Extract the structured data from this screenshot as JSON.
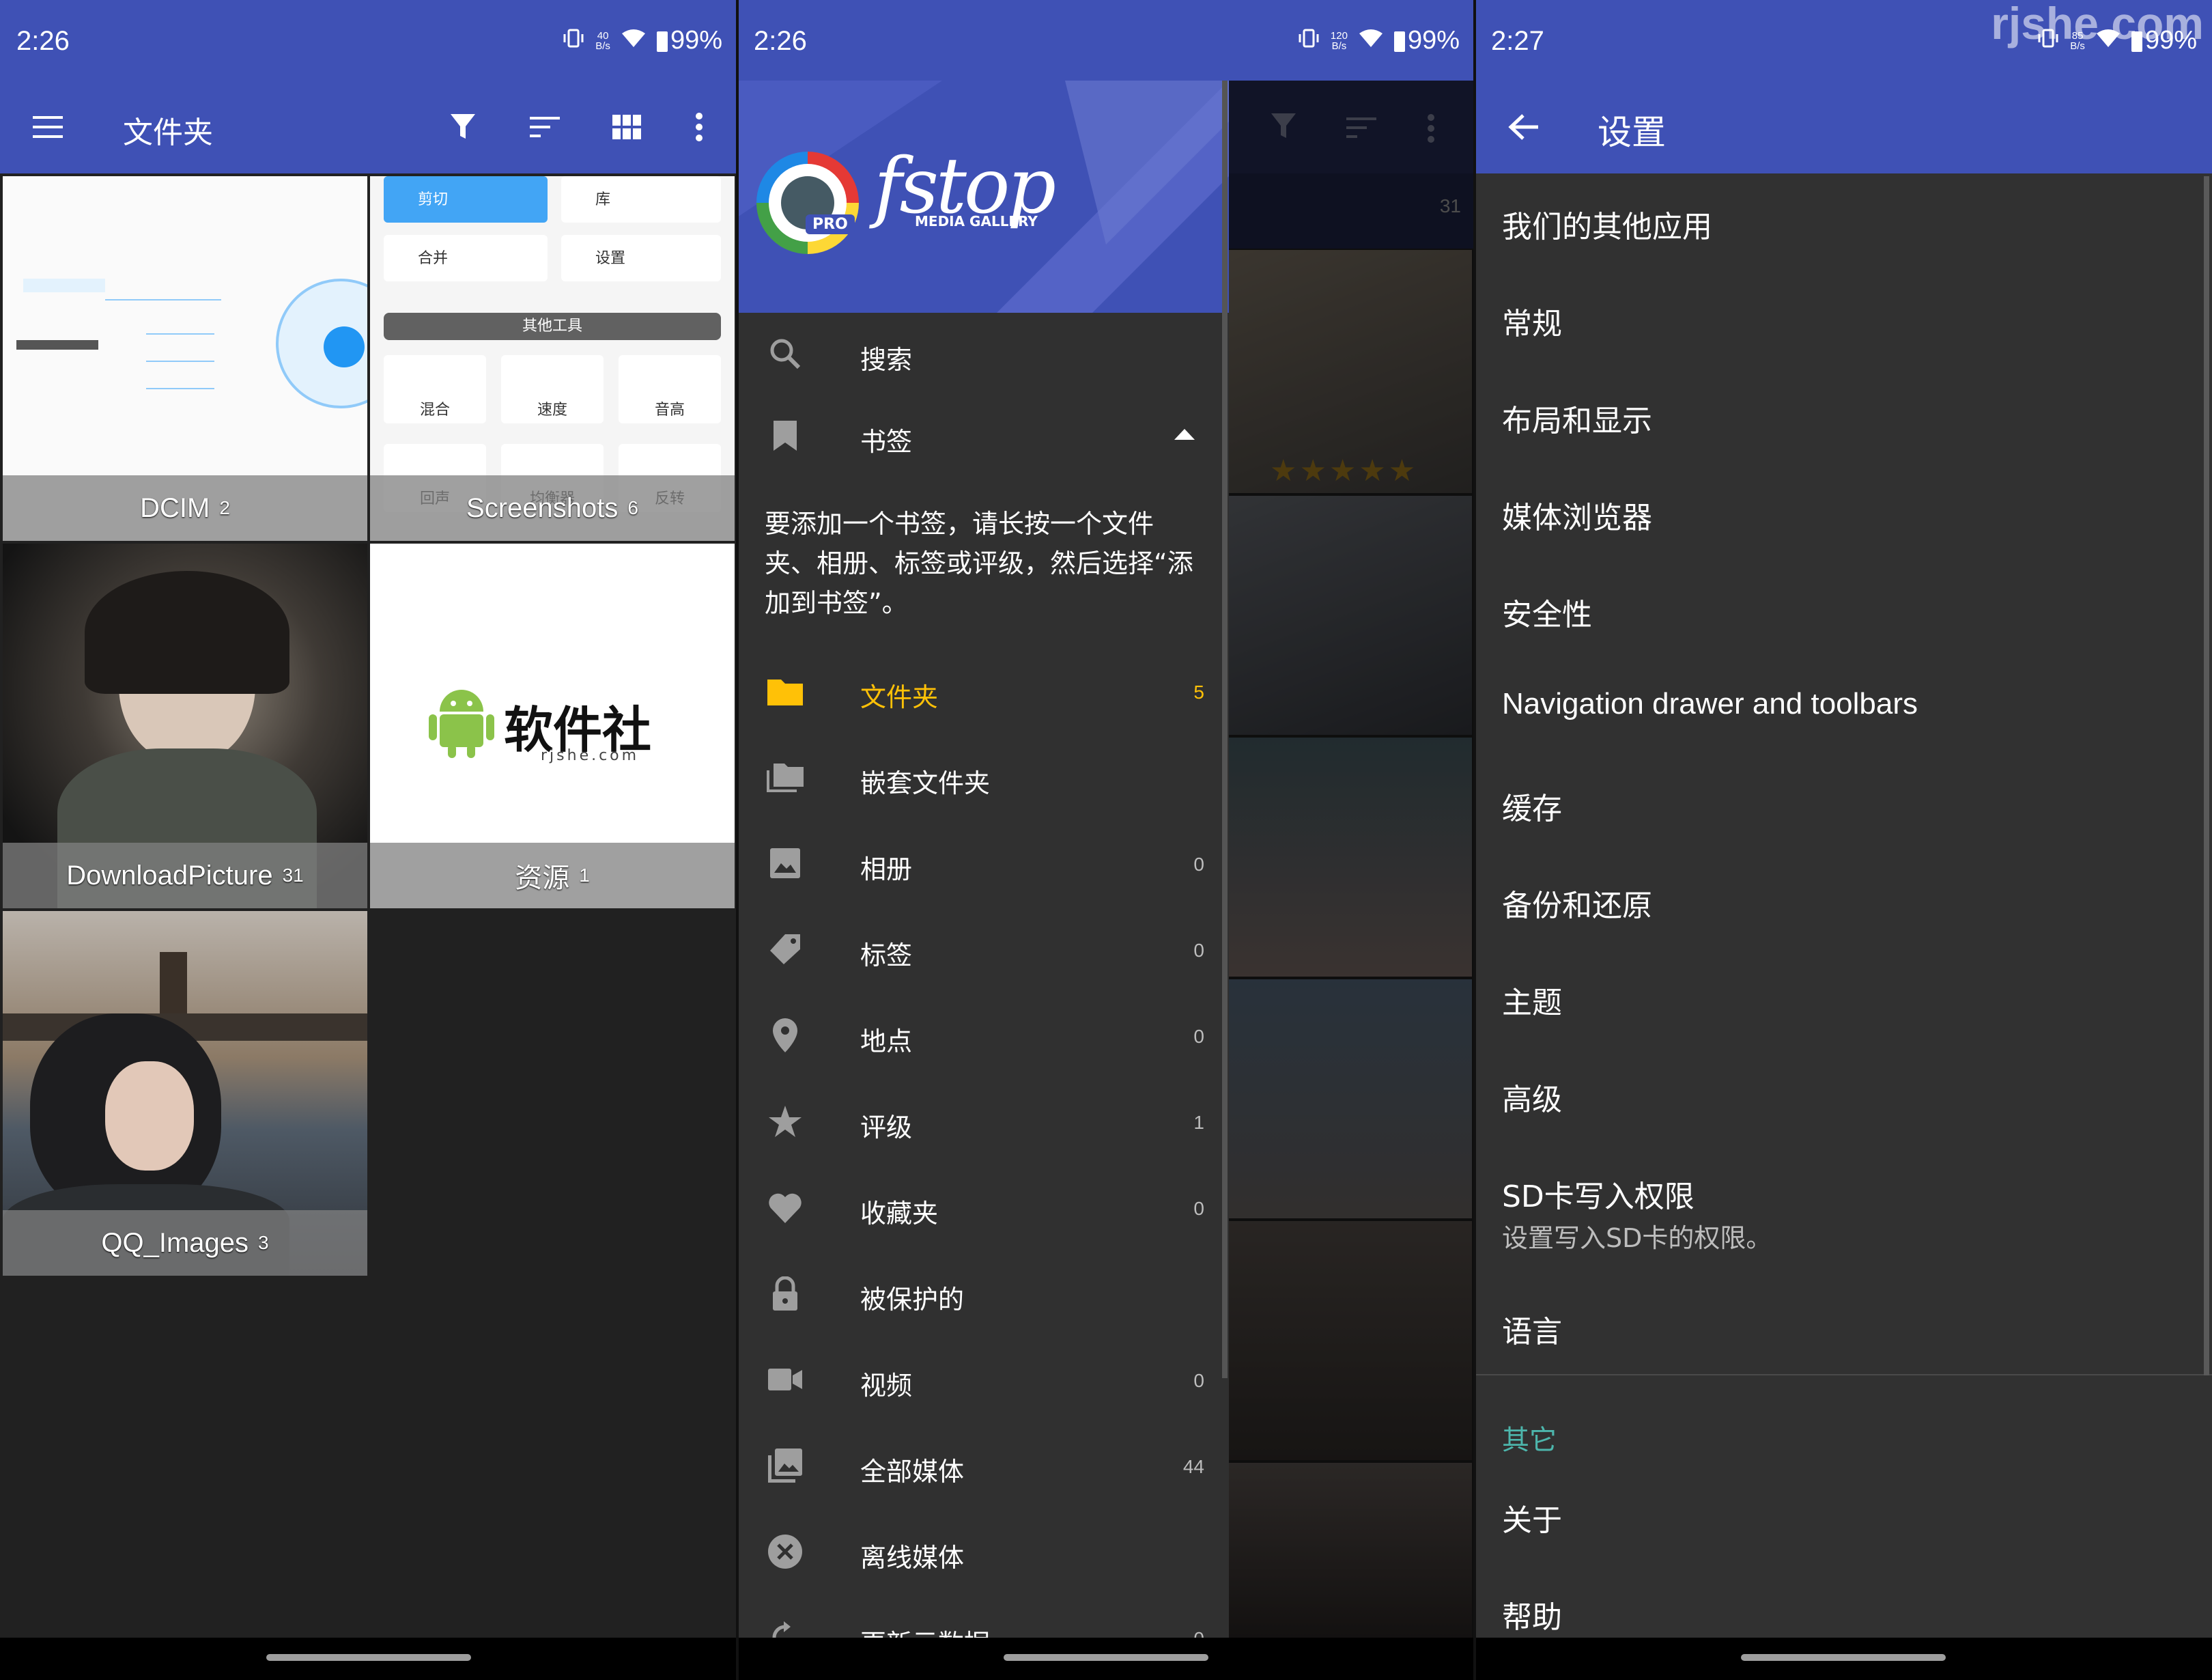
{
  "watermark": "rjshe.com",
  "panel1": {
    "status": {
      "time": "2:26",
      "speed": "40\nB/s",
      "battery": "99%"
    },
    "toolbar": {
      "title": "文件夹",
      "icons": [
        "menu-icon",
        "filter-icon",
        "sort-icon",
        "grid-view-icon",
        "more-vert-icon"
      ]
    },
    "folders": [
      {
        "name": "DCIM",
        "count": "2"
      },
      {
        "name": "Screenshots",
        "count": "6"
      },
      {
        "name": "DownloadPicture",
        "count": "31"
      },
      {
        "name": "资源",
        "count": "1"
      },
      {
        "name": "QQ_Images",
        "count": "3"
      }
    ],
    "screenshot_thumb": {
      "items": [
        "剪切",
        "库",
        "合并",
        "设置"
      ],
      "section": "其他工具",
      "tools": [
        "混合",
        "速度",
        "音高",
        "回声",
        "均衡器",
        "反转"
      ]
    },
    "resource_thumb": {
      "brand": "软件社",
      "sub": "rjshe.com"
    },
    "colors": {
      "primary": "#3f51b5",
      "accent": "#ffc107"
    }
  },
  "panel2": {
    "status": {
      "time": "2:26",
      "speed": "120\nB/s",
      "battery": "99%"
    },
    "logo": {
      "text": "fstop",
      "sub": "MEDIA GALLERY",
      "badge": "PRO"
    },
    "count_behind": "31",
    "bookmark_hint": "要添加一个书签，请长按一个文件夹、相册、标签或评级，然后选择“添加到书签”。",
    "items": [
      {
        "label": "搜索",
        "icon": "search-icon",
        "count": ""
      },
      {
        "label": "书签",
        "icon": "bookmark-icon",
        "count": ""
      },
      {
        "label": "文件夹",
        "icon": "folder-icon",
        "count": "5",
        "active": true
      },
      {
        "label": "嵌套文件夹",
        "icon": "nested-folder-icon",
        "count": ""
      },
      {
        "label": "相册",
        "icon": "album-icon",
        "count": "0"
      },
      {
        "label": "标签",
        "icon": "tag-icon",
        "count": "0"
      },
      {
        "label": "地点",
        "icon": "location-icon",
        "count": "0"
      },
      {
        "label": "评级",
        "icon": "star-icon",
        "count": "1"
      },
      {
        "label": "收藏夹",
        "icon": "heart-icon",
        "count": "0"
      },
      {
        "label": "被保护的",
        "icon": "lock-icon",
        "count": ""
      },
      {
        "label": "视频",
        "icon": "video-icon",
        "count": "0"
      },
      {
        "label": "全部媒体",
        "icon": "all-media-icon",
        "count": "44"
      },
      {
        "label": "离线媒体",
        "icon": "offline-icon",
        "count": ""
      },
      {
        "label": "更新元数据",
        "icon": "refresh-icon",
        "count": "0"
      }
    ]
  },
  "panel3": {
    "status": {
      "time": "2:27",
      "speed": "85\nB/s",
      "battery": "99%"
    },
    "toolbar": {
      "title": "设置"
    },
    "items": [
      {
        "label": "我们的其他应用"
      },
      {
        "label": "常规"
      },
      {
        "label": "布局和显示"
      },
      {
        "label": "媒体浏览器"
      },
      {
        "label": "安全性"
      },
      {
        "label": "Navigation drawer and toolbars"
      },
      {
        "label": "缓存"
      },
      {
        "label": "备份和还原"
      },
      {
        "label": "主题"
      },
      {
        "label": "高级"
      },
      {
        "label": "SD卡写入权限",
        "sub": "设置写入SD卡的权限。"
      },
      {
        "label": "语言"
      }
    ],
    "section_other": "其它",
    "other_items": [
      {
        "label": "关于"
      },
      {
        "label": "帮助"
      }
    ],
    "colors": {
      "section": "#4db6ac"
    }
  }
}
